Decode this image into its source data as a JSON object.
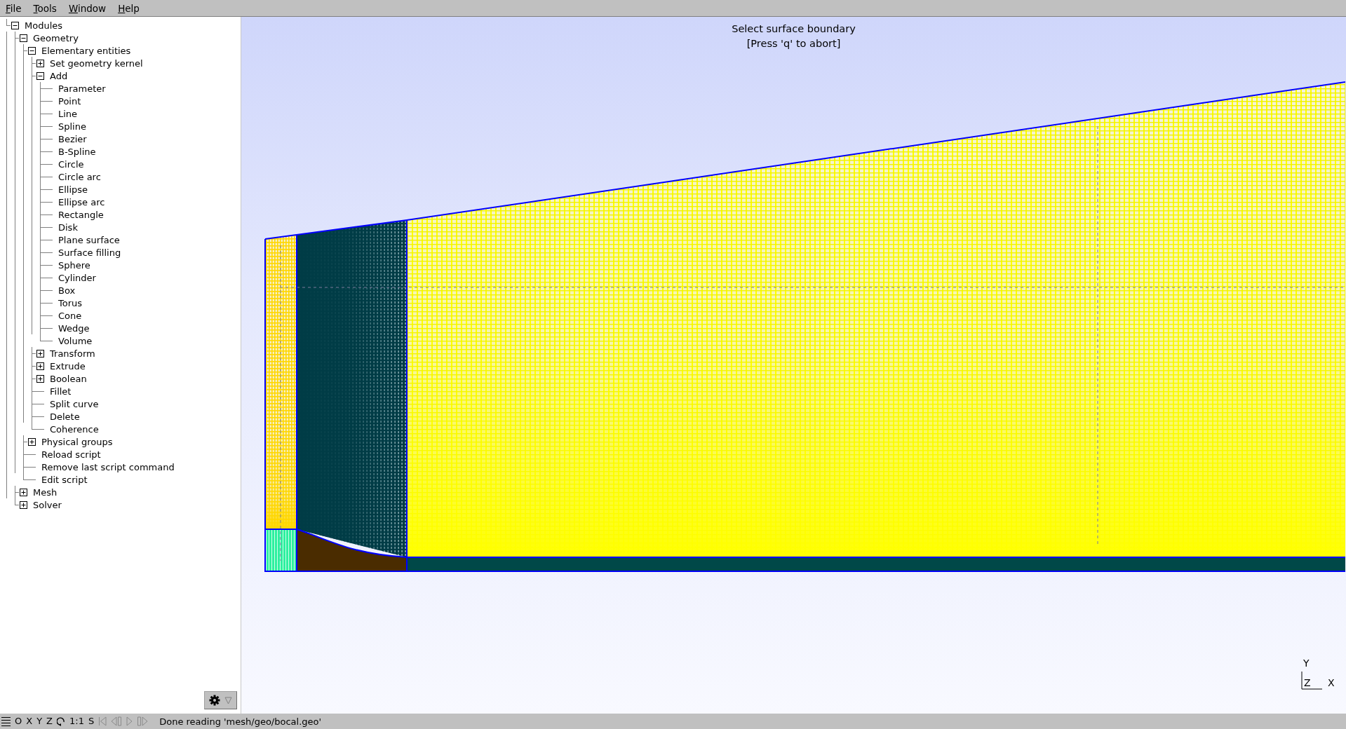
{
  "menu_bar": [
    "File",
    "Tools",
    "Window",
    "Help"
  ],
  "tree": [
    {
      "label": "Modules",
      "expanded": true,
      "children": [
        {
          "label": "Geometry",
          "expanded": true,
          "children": [
            {
              "label": "Elementary entities",
              "expanded": true,
              "children": [
                {
                  "label": "Set geometry kernel",
                  "expanded": false
                },
                {
                  "label": "Add",
                  "expanded": true,
                  "children": [
                    {
                      "label": "Parameter"
                    },
                    {
                      "label": "Point"
                    },
                    {
                      "label": "Line"
                    },
                    {
                      "label": "Spline"
                    },
                    {
                      "label": "Bezier"
                    },
                    {
                      "label": "B-Spline"
                    },
                    {
                      "label": "Circle"
                    },
                    {
                      "label": "Circle arc"
                    },
                    {
                      "label": "Ellipse"
                    },
                    {
                      "label": "Ellipse arc"
                    },
                    {
                      "label": "Rectangle"
                    },
                    {
                      "label": "Disk"
                    },
                    {
                      "label": "Plane surface"
                    },
                    {
                      "label": "Surface filling"
                    },
                    {
                      "label": "Sphere"
                    },
                    {
                      "label": "Cylinder"
                    },
                    {
                      "label": "Box"
                    },
                    {
                      "label": "Torus"
                    },
                    {
                      "label": "Cone"
                    },
                    {
                      "label": "Wedge"
                    },
                    {
                      "label": "Volume"
                    }
                  ]
                },
                {
                  "label": "Transform",
                  "expanded": false
                },
                {
                  "label": "Extrude",
                  "expanded": false
                },
                {
                  "label": "Boolean",
                  "expanded": false
                },
                {
                  "label": "Fillet"
                },
                {
                  "label": "Split curve"
                },
                {
                  "label": "Delete"
                },
                {
                  "label": "Coherence"
                }
              ]
            },
            {
              "label": "Physical groups",
              "expanded": false
            },
            {
              "label": "Reload script"
            },
            {
              "label": "Remove last script command"
            },
            {
              "label": "Edit script"
            }
          ]
        },
        {
          "label": "Mesh",
          "expanded": false
        },
        {
          "label": "Solver",
          "expanded": false
        }
      ]
    }
  ],
  "viewport": {
    "message": [
      "Select surface boundary",
      "[Press 'q' to abort]"
    ],
    "axes": {
      "y": "Y",
      "z": "Z",
      "x": "X"
    }
  },
  "status_bar": {
    "view_buttons": [
      "O",
      "X",
      "Y",
      "Z"
    ],
    "scale_buttons": [
      "1:1",
      "S"
    ],
    "message": "Done reading 'mesh/geo/bocal.geo'"
  }
}
